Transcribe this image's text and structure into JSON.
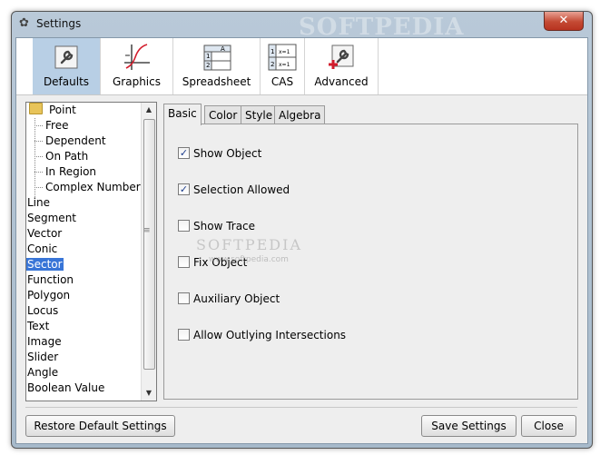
{
  "window": {
    "title": "Settings",
    "watermark": "SOFTPEDIA",
    "close_label": "✕"
  },
  "toolbar": {
    "items": [
      {
        "label": "Defaults",
        "icon": "wrench-icon",
        "active": true
      },
      {
        "label": "Graphics",
        "icon": "graph-icon",
        "active": false
      },
      {
        "label": "Spreadsheet",
        "icon": "spreadsheet-icon",
        "active": false
      },
      {
        "label": "CAS",
        "icon": "cas-icon",
        "active": false
      },
      {
        "label": "Advanced",
        "icon": "advanced-wrench-icon",
        "active": false
      }
    ]
  },
  "tree": {
    "items": [
      {
        "label": "Point",
        "level": 0,
        "folder": true
      },
      {
        "label": "Free",
        "level": 1
      },
      {
        "label": "Dependent",
        "level": 1
      },
      {
        "label": "On Path",
        "level": 1
      },
      {
        "label": "In Region",
        "level": 1
      },
      {
        "label": "Complex Number",
        "level": 1
      },
      {
        "label": "Line",
        "level": 0
      },
      {
        "label": "Segment",
        "level": 0
      },
      {
        "label": "Vector",
        "level": 0
      },
      {
        "label": "Conic",
        "level": 0
      },
      {
        "label": "Sector",
        "level": 0,
        "selected": true
      },
      {
        "label": "Function",
        "level": 0
      },
      {
        "label": "Polygon",
        "level": 0
      },
      {
        "label": "Locus",
        "level": 0
      },
      {
        "label": "Text",
        "level": 0
      },
      {
        "label": "Image",
        "level": 0
      },
      {
        "label": "Slider",
        "level": 0
      },
      {
        "label": "Angle",
        "level": 0
      },
      {
        "label": "Boolean Value",
        "level": 0
      }
    ],
    "grip": "≡"
  },
  "tabs": {
    "items": [
      {
        "label": "Basic",
        "active": true
      },
      {
        "label": "Color",
        "active": false
      },
      {
        "label": "Style",
        "active": false
      },
      {
        "label": "Algebra",
        "active": false
      }
    ]
  },
  "basic": {
    "checkboxes": [
      {
        "label": "Show Object",
        "checked": true
      },
      {
        "label": "Selection Allowed",
        "checked": true
      },
      {
        "label": "Show Trace",
        "checked": false
      },
      {
        "label": "Fix Object",
        "checked": false
      },
      {
        "label": "Auxiliary Object",
        "checked": false
      },
      {
        "label": "Allow Outlying Intersections",
        "checked": false
      }
    ],
    "check_mark": "✓"
  },
  "watermark_center": {
    "text": "SOFTPEDIA",
    "sub": "www.softpedia.com"
  },
  "footer": {
    "restore_label": "Restore Default Settings",
    "save_label": "Save Settings",
    "close_label": "Close"
  },
  "colors": {
    "selection": "#3875d7",
    "active_tab_bg": "#b8cfe5",
    "close_red": "#c44a34"
  }
}
